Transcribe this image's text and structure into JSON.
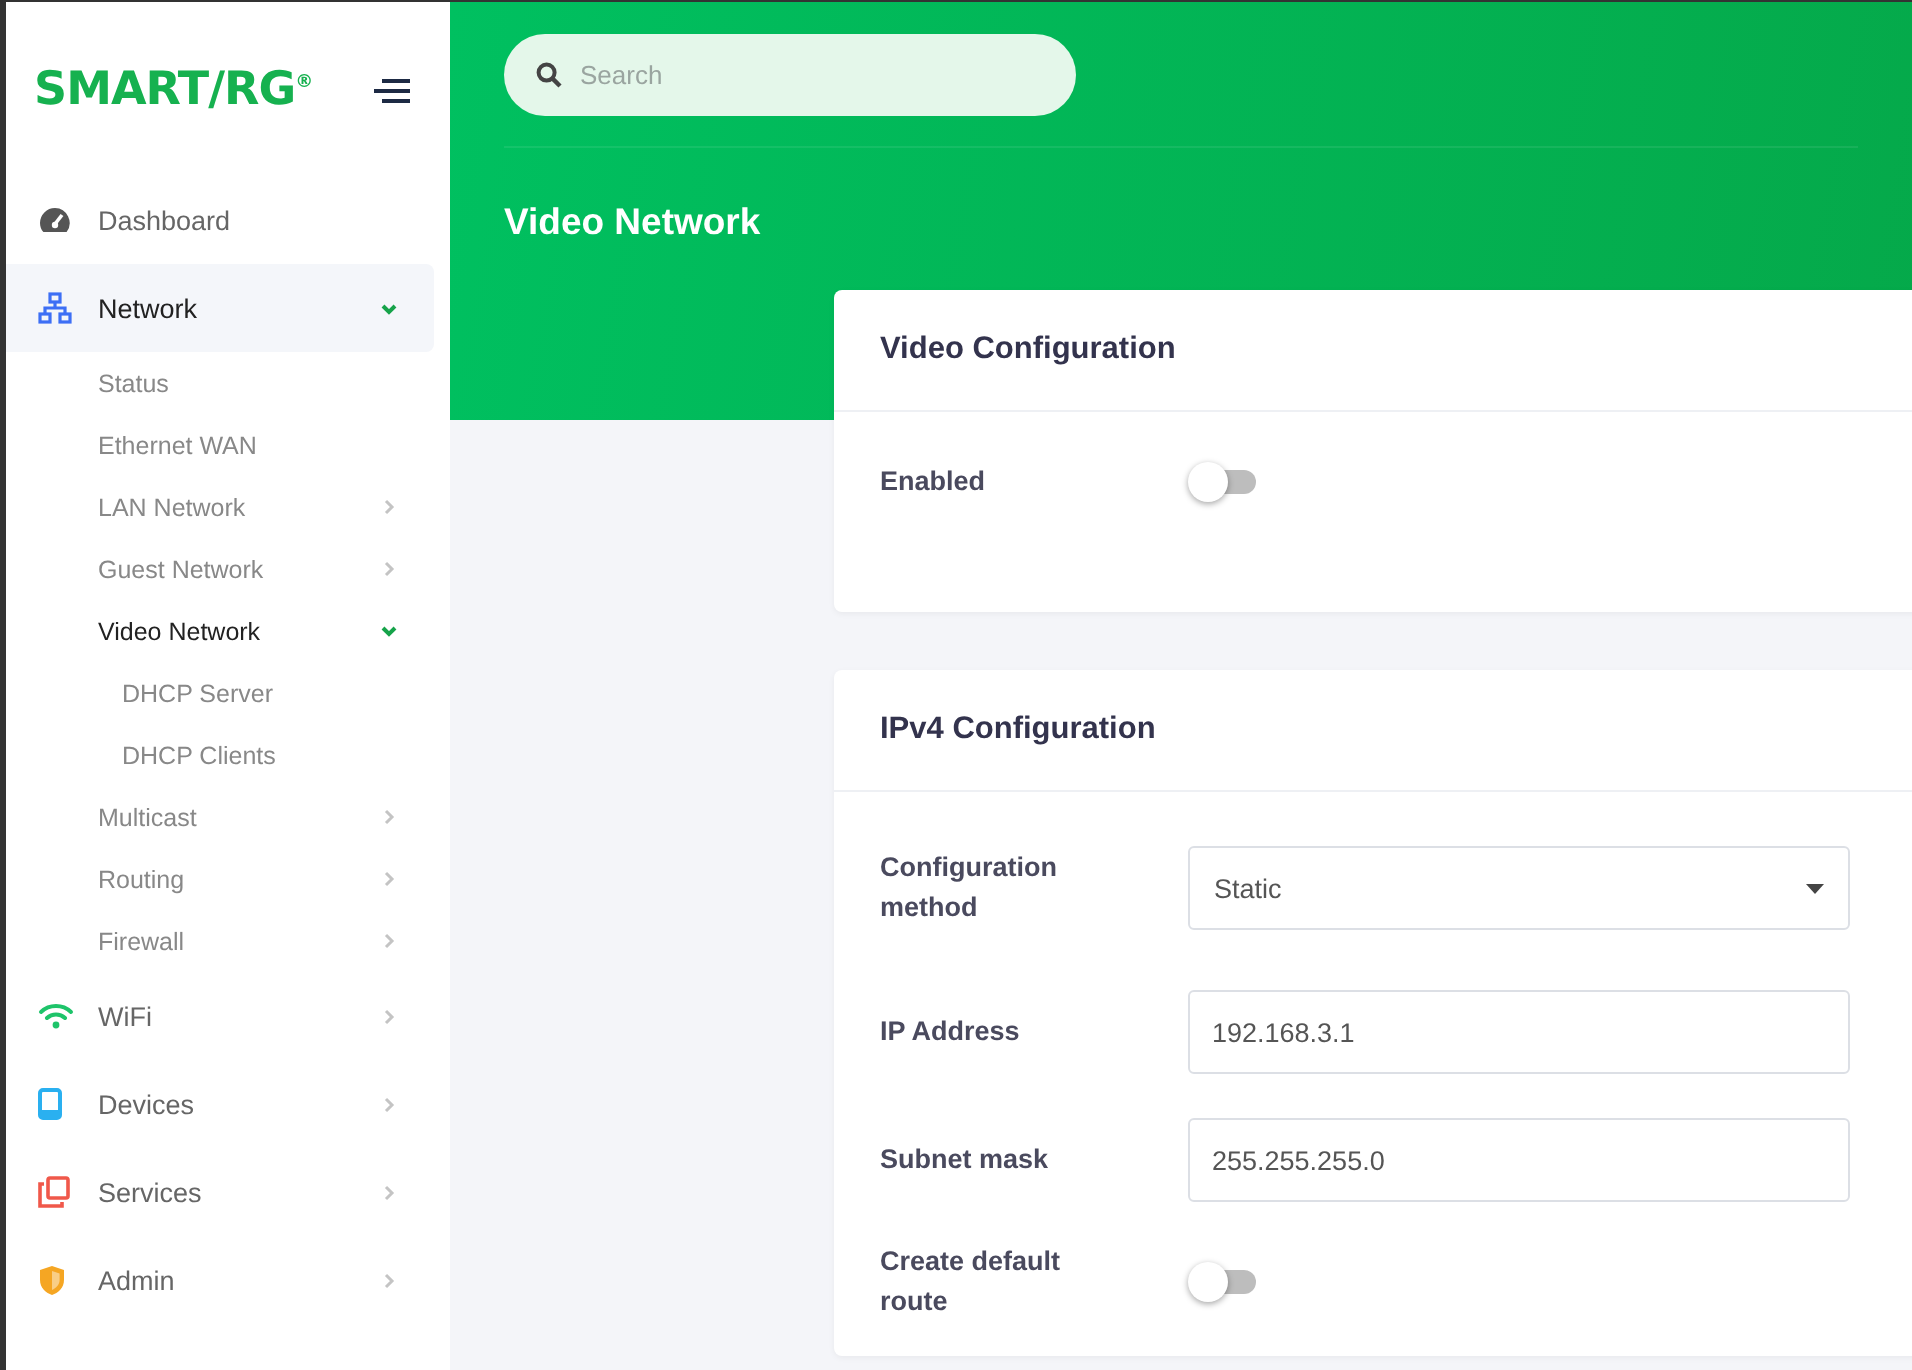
{
  "logo": "SMART/RG$^{®}$",
  "sidebar": {
    "items": [
      {
        "label": "Dashboard",
        "selected": false
      },
      {
        "label": "Network",
        "selected": true,
        "expanded": true,
        "children": [
          {
            "label": "Status",
            "selected": false
          },
          {
            "label": "Ethernet WAN",
            "selected": false
          },
          {
            "label": "LAN Network",
            "selected": false,
            "expanded": false
          },
          {
            "label": "Guest Network",
            "selected": false,
            "expanded": false
          },
          {
            "label": "Video Network",
            "selected": true,
            "expanded": true,
            "children": [
              {
                "label": "DHCP Server",
                "selected": false
              },
              {
                "label": "DHCP Clients",
                "selected": false
              }
            ]
          },
          {
            "label": "Multicast",
            "selected": false,
            "expanded": false
          },
          {
            "label": "Routing",
            "selected": false,
            "expanded": false
          },
          {
            "label": "Firewall",
            "selected": false,
            "expanded": false
          }
        ]
      },
      {
        "label": "WiFi",
        "selected": false,
        "expanded": false
      },
      {
        "label": "Devices",
        "selected": false,
        "expanded": false
      },
      {
        "label": "Services",
        "selected": false,
        "expanded": false
      },
      {
        "label": "Admin",
        "selected": false,
        "expanded": false
      }
    ]
  },
  "search": {
    "placeholder": "Search"
  },
  "page_title": "Video Network",
  "cards": [
    {
      "title": "Video Configuration",
      "rows": [
        {
          "kind": "toggle",
          "label": "Enabled",
          "on": false
        }
      ]
    },
    {
      "title": "IPv4 Configuration",
      "rows": [
        {
          "kind": "select",
          "label": "Configuration method",
          "value": "Static"
        },
        {
          "kind": "text",
          "label": "IP Address",
          "value": "192.168.3.1"
        },
        {
          "kind": "text",
          "label": "Subnet mask",
          "value": "255.255.255.0"
        },
        {
          "kind": "toggle",
          "label": "Create default route",
          "on": false
        }
      ]
    }
  ]
}
